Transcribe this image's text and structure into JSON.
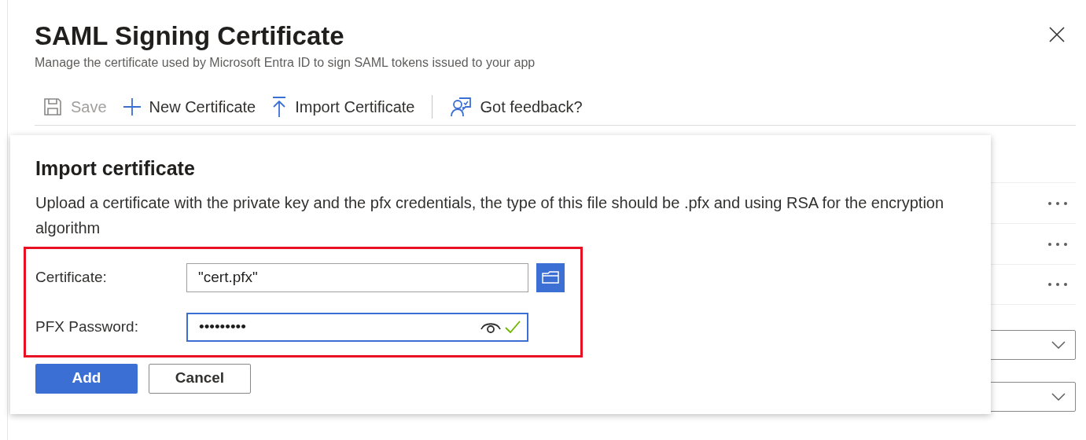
{
  "header": {
    "title": "SAML Signing Certificate",
    "subtitle": "Manage the certificate used by Microsoft Entra ID to sign SAML tokens issued to your app"
  },
  "toolbar": [
    {
      "kind": "save",
      "label": "Save",
      "disabled": true
    },
    {
      "kind": "new",
      "label": "New Certificate",
      "disabled": false
    },
    {
      "kind": "import",
      "label": "Import Certificate",
      "disabled": false
    },
    {
      "kind": "feedback",
      "label": "Got feedback?",
      "disabled": false
    }
  ],
  "dialog": {
    "title": "Import certificate",
    "description": "Upload a certificate with the private key and the pfx credentials, the type of this file should be .pfx and using RSA for the encryption algorithm",
    "fields": [
      {
        "kind": "file",
        "label": "Certificate:",
        "value": "\"cert.pfx\"",
        "focused": false
      },
      {
        "kind": "password",
        "label": "PFX Password:",
        "value": "•••••••••",
        "focused": true,
        "valid": true
      }
    ],
    "buttons": [
      {
        "label": "Add",
        "primary": true
      },
      {
        "label": "Cancel",
        "primary": false
      }
    ]
  }
}
